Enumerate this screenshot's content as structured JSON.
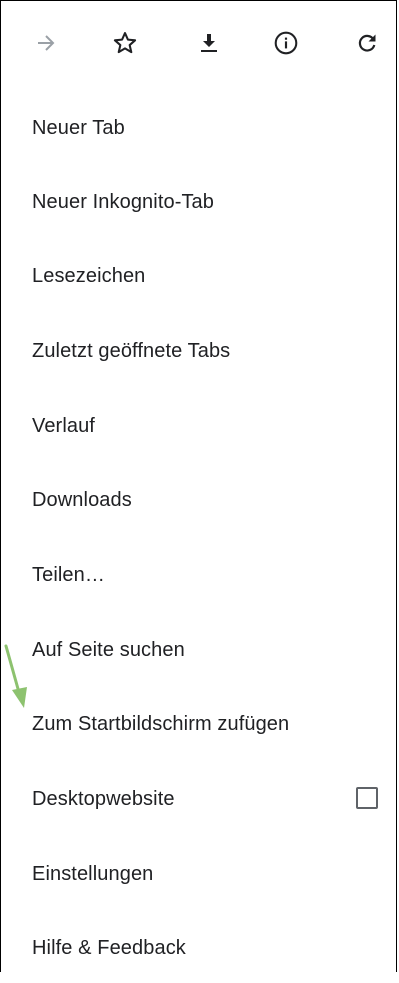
{
  "toolbar": {
    "icons": [
      "forward-arrow-icon",
      "bookmark-star-icon",
      "download-icon",
      "info-icon",
      "reload-icon"
    ]
  },
  "menu": {
    "items": [
      {
        "label": "Neuer Tab"
      },
      {
        "label": "Neuer Inkognito-Tab"
      },
      {
        "label": "Lesezeichen"
      },
      {
        "label": "Zuletzt geöffnete Tabs"
      },
      {
        "label": "Verlauf"
      },
      {
        "label": "Downloads"
      },
      {
        "label": "Teilen…"
      },
      {
        "label": "Auf Seite suchen"
      },
      {
        "label": "Zum Startbildschirm zufügen"
      },
      {
        "label": "Desktopwebsite",
        "checked": false
      },
      {
        "label": "Einstellungen"
      },
      {
        "label": "Hilfe & Feedback"
      }
    ]
  },
  "colors": {
    "text": "#202124",
    "icon": "#202124",
    "disabled_icon": "#9aa0a6",
    "annotation_arrow": "#8dc26f",
    "frame_border": "#000000"
  }
}
